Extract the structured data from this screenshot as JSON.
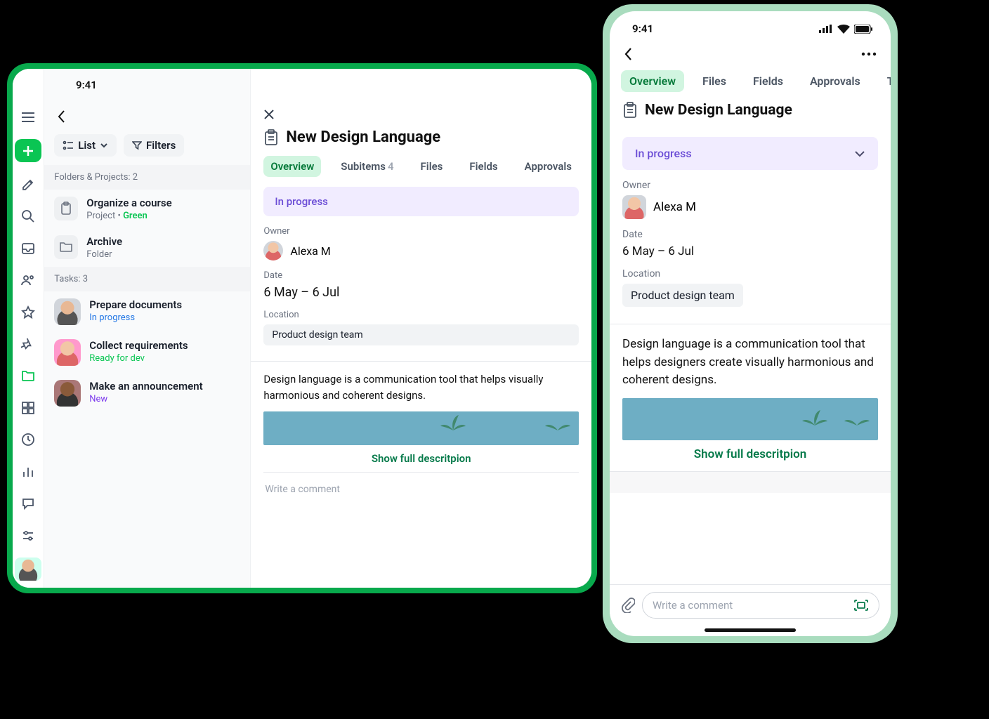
{
  "statusbar_time": "9:41",
  "sidebar": {
    "rail_icons": [
      "menu",
      "plus",
      "edit",
      "search",
      "inbox",
      "people",
      "star",
      "pin",
      "folder",
      "grid",
      "clock",
      "chart",
      "chat",
      "sliders"
    ]
  },
  "list_pane": {
    "view_label": "List",
    "filters_label": "Filters",
    "folders_header": "Folders & Projects: 2",
    "tasks_header": "Tasks: 3",
    "folders": [
      {
        "title": "Organize a course",
        "sub_prefix": "Project • ",
        "status": "Green",
        "icon": "clipboard"
      },
      {
        "title": "Archive",
        "sub": "Folder",
        "icon": "folder"
      }
    ],
    "tasks": [
      {
        "title": "Prepare documents",
        "status": "In progress",
        "status_class": "blue"
      },
      {
        "title": "Collect requirements",
        "status": "Ready for dev",
        "status_class": "green"
      },
      {
        "title": "Make an announcement",
        "status": "New",
        "status_class": "purple"
      }
    ]
  },
  "detail": {
    "title": "New Design Language",
    "tabs": [
      {
        "label": "Overview",
        "active": true
      },
      {
        "label": "Subitems",
        "count": "4"
      },
      {
        "label": "Files"
      },
      {
        "label": "Fields"
      },
      {
        "label": "Approvals"
      }
    ],
    "status": "In progress",
    "owner_label": "Owner",
    "owner_name": "Alexa M",
    "date_label": "Date",
    "date_value": "6 May – 6 Jul",
    "location_label": "Location",
    "location_value": "Product design team",
    "description": "Design language is a communication tool that helps designers create visually harmonious and coherent designs.",
    "description_tablet": "Design language is a communication tool that helps visually harmonious and coherent designs.",
    "show_full": "Show full descritpion",
    "comment_placeholder": "Write a comment"
  },
  "phone_tabs": [
    {
      "label": "Overview",
      "active": true
    },
    {
      "label": "Files"
    },
    {
      "label": "Fields"
    },
    {
      "label": "Approvals"
    },
    {
      "label": "Time t"
    }
  ]
}
